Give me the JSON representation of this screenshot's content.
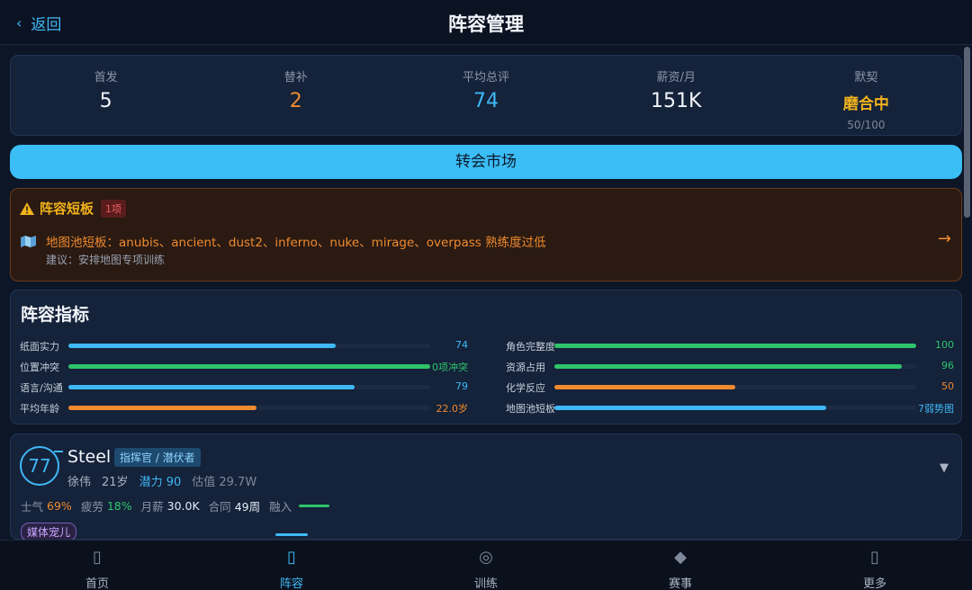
{
  "header": {
    "back_label": "返回",
    "title": "阵容管理"
  },
  "stats": [
    {
      "label": "首发",
      "value": "5",
      "color": "white"
    },
    {
      "label": "替补",
      "value": "2",
      "color": "orange"
    },
    {
      "label": "平均总评",
      "value": "74",
      "color": "blue"
    },
    {
      "label": "薪资/月",
      "value": "151K",
      "color": "white"
    },
    {
      "label": "默契",
      "value": "磨合中",
      "color": "gold",
      "sub": "50/100"
    }
  ],
  "transfer_button": "转会市场",
  "warning": {
    "title": "阵容短板",
    "badge": "1项",
    "message": "地图池短板：anubis、ancient、dust2、inferno、nuke、mirage、overpass 熟练度过低",
    "suggestion": "建议：安排地图专项训练",
    "arrow": "→"
  },
  "metrics": {
    "title": "阵容指标",
    "left": [
      {
        "label": "纸面实力",
        "value": "74",
        "fill": 0.74,
        "color": "#3fb8f5"
      },
      {
        "label": "位置冲突",
        "value": "0项冲突",
        "fill": 1.0,
        "color": "#2ec56a"
      },
      {
        "label": "语言/沟通",
        "value": "79",
        "fill": 0.79,
        "color": "#3fb8f5"
      },
      {
        "label": "平均年龄",
        "value": "22.0岁",
        "fill": 0.52,
        "color": "#f08a2e"
      }
    ],
    "right": [
      {
        "label": "角色完整度",
        "value": "100",
        "fill": 1.0,
        "color": "#2ec56a"
      },
      {
        "label": "资源占用",
        "value": "96",
        "fill": 0.96,
        "color": "#2ec56a"
      },
      {
        "label": "化学反应",
        "value": "50",
        "fill": 0.5,
        "color": "#f08a2e"
      },
      {
        "label": "地图池短板",
        "value": "7弱势图",
        "fill": 0.75,
        "color": "#3fb8f5"
      }
    ]
  },
  "player": {
    "rating": "77",
    "name": "Steel",
    "role": "指挥官 / 潜伏者",
    "real_name": "徐伟",
    "age": "21岁",
    "potential": "潜力 90",
    "valuation": "估值 29.7W",
    "morale_label": "士气",
    "morale": "69%",
    "fatigue_label": "疲劳",
    "fatigue": "18%",
    "salary_label": "月薪",
    "salary": "30.0K",
    "contract_label": "合同",
    "contract": "49周",
    "fusion_label": "融入",
    "tag": "媒体宠儿"
  },
  "nav": [
    {
      "label": "首页",
      "icon": "home-icon"
    },
    {
      "label": "阵容",
      "icon": "lineup-icon",
      "active": true
    },
    {
      "label": "训练",
      "icon": "target-icon"
    },
    {
      "label": "赛事",
      "icon": "diamond-icon"
    },
    {
      "label": "更多",
      "icon": "more-icon"
    }
  ]
}
